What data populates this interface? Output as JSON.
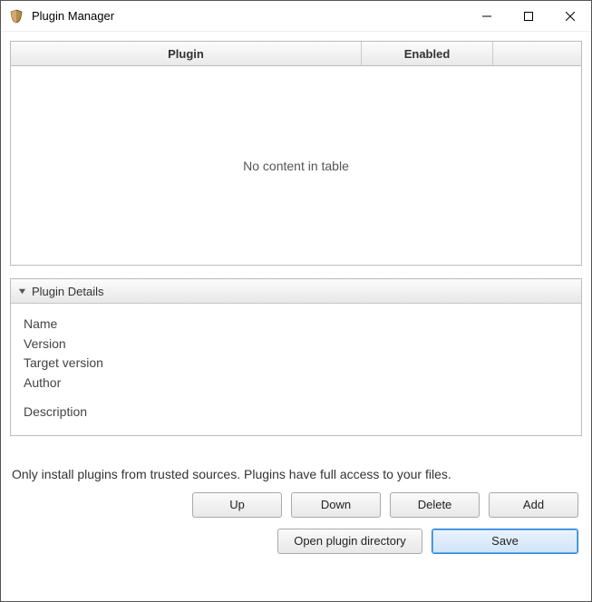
{
  "window": {
    "title": "Plugin Manager"
  },
  "table": {
    "columns": {
      "plugin": "Plugin",
      "enabled": "Enabled"
    },
    "empty_text": "No content in table"
  },
  "details": {
    "header": "Plugin Details",
    "fields": {
      "name": "Name",
      "version": "Version",
      "target_version": "Target version",
      "author": "Author",
      "description": "Description"
    }
  },
  "warning": "Only install plugins from trusted sources. Plugins have full access to your files.",
  "buttons": {
    "up": "Up",
    "down": "Down",
    "delete": "Delete",
    "add": "Add",
    "open_dir": "Open plugin directory",
    "save": "Save"
  }
}
